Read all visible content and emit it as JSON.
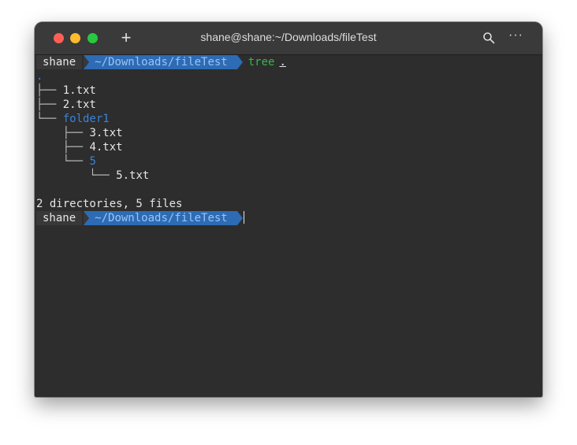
{
  "window": {
    "title": "shane@shane:~/Downloads/fileTest",
    "new_tab_label": "+",
    "more_label": "···"
  },
  "prompt1": {
    "user": "shane",
    "path": "~/Downloads/fileTest",
    "command": "tree",
    "argument": "."
  },
  "tree": {
    "root": ".",
    "entries": [
      {
        "prefix": "├── ",
        "name": "1.txt"
      },
      {
        "prefix": "├── ",
        "name": "2.txt"
      },
      {
        "prefix": "└── ",
        "name": "folder1"
      },
      {
        "prefix": "    ├── ",
        "name": "3.txt"
      },
      {
        "prefix": "    ├── ",
        "name": "4.txt"
      },
      {
        "prefix": "    └── ",
        "name": "5"
      },
      {
        "prefix": "        └── ",
        "name": "5.txt"
      }
    ],
    "summary": "2 directories, 5 files"
  },
  "prompt2": {
    "user": "shane",
    "path": "~/Downloads/fileTest"
  },
  "colors": {
    "directory": "#3b82d6",
    "command": "#39b54a",
    "path_segment": "#2d6bb5"
  }
}
